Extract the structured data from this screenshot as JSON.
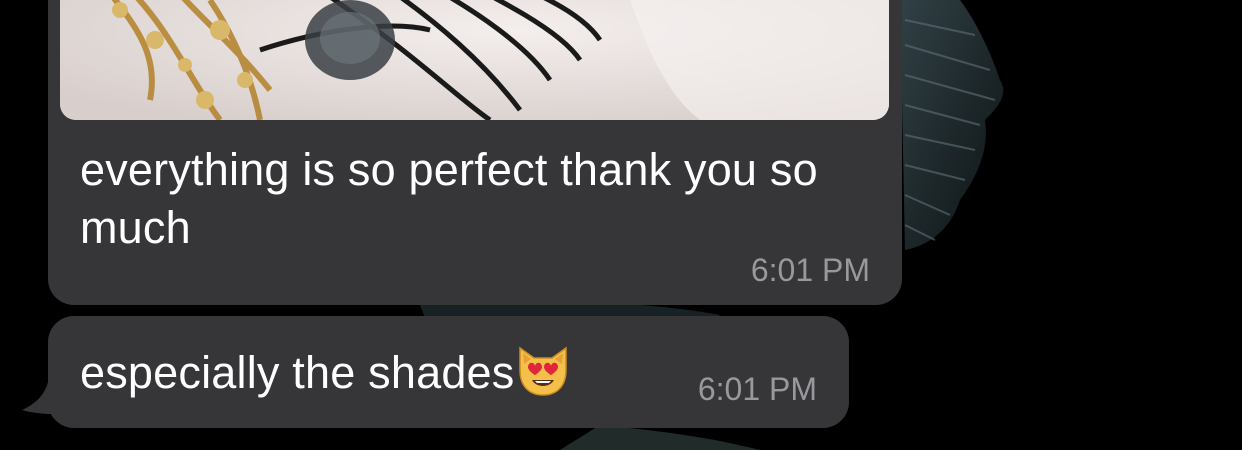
{
  "messages": [
    {
      "text": "everything is so perfect thank you so much",
      "time": "6:01 PM",
      "attachment": "photo of gold jewelry and black cords in plastic bag"
    },
    {
      "text": "especially the shades",
      "emoji": "smiling-cat-heart-eyes",
      "time": "6:01 PM"
    }
  ],
  "colors": {
    "background": "#000000",
    "bubble": "#363638",
    "text": "#ffffff",
    "timestamp": "#98989d"
  }
}
